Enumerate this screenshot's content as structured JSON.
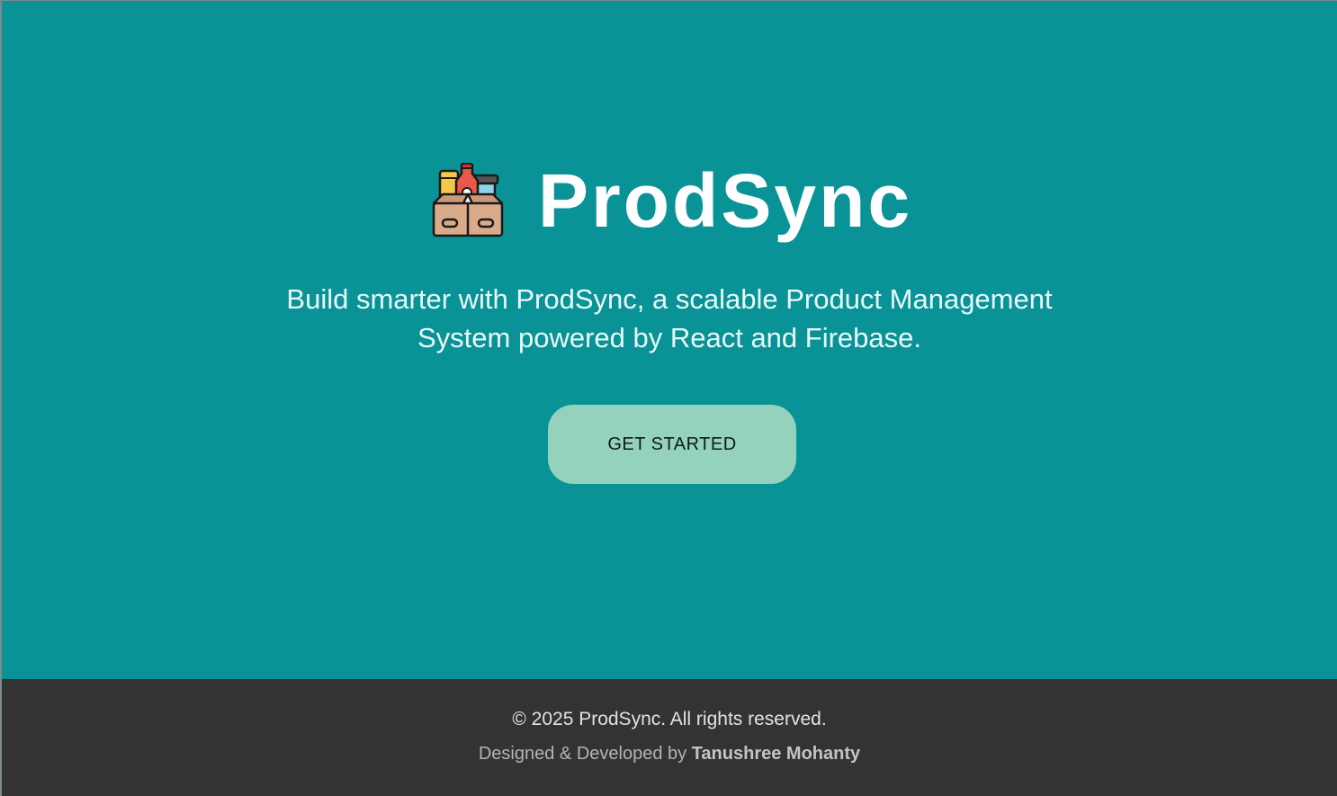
{
  "hero": {
    "title": "ProdSync",
    "logo_icon": "product-box-icon",
    "tagline_line1": "Build smarter with ProdSync, a scalable Product Management",
    "tagline_line2": "System powered by React and Firebase.",
    "cta_label": "GET STARTED"
  },
  "footer": {
    "copyright": "© 2025 ProdSync. All rights reserved.",
    "credit_prefix": "Designed & Developed by",
    "credit_name": "Tanushree Mohanty"
  },
  "colors": {
    "hero_bg": "#0a9396",
    "cta_bg": "#94d2bd",
    "footer_bg": "#333333"
  }
}
